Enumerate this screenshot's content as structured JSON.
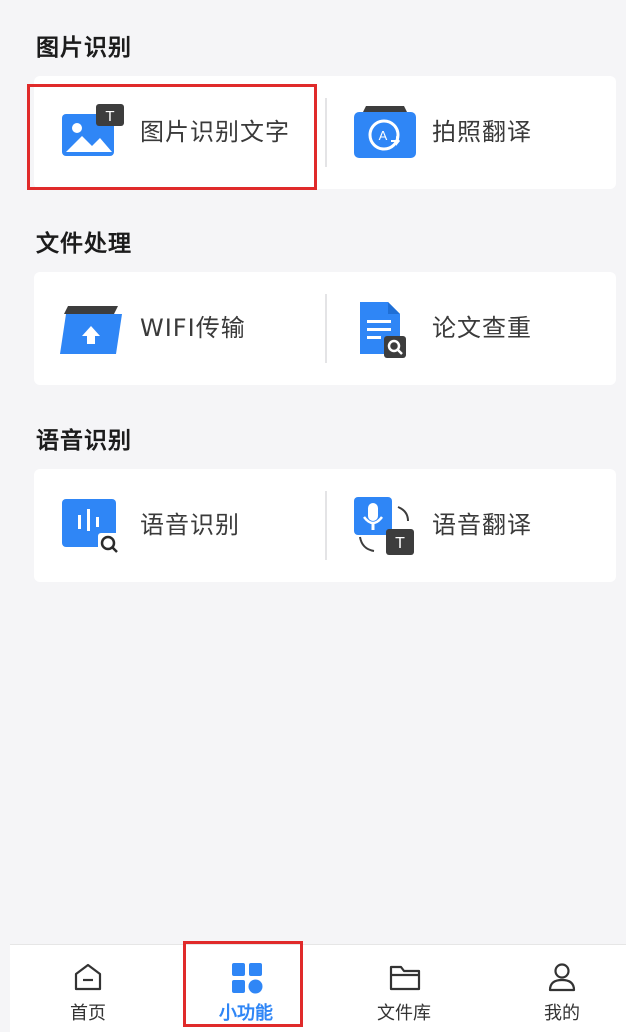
{
  "sections": [
    {
      "title": "图片识别",
      "items": [
        {
          "label": "图片识别文字",
          "icon": "image-text-icon"
        },
        {
          "label": "拍照翻译",
          "icon": "camera-translate-icon"
        }
      ]
    },
    {
      "title": "文件处理",
      "items": [
        {
          "label": "WIFI传输",
          "icon": "wifi-upload-folder-icon"
        },
        {
          "label": "论文查重",
          "icon": "document-search-icon"
        }
      ]
    },
    {
      "title": "语音识别",
      "items": [
        {
          "label": "语音识别",
          "icon": "voice-search-icon"
        },
        {
          "label": "语音翻译",
          "icon": "mic-translate-icon"
        }
      ]
    }
  ],
  "bottom_nav": {
    "items": [
      {
        "label": "首页",
        "icon": "home-icon",
        "active": false
      },
      {
        "label": "小功能",
        "icon": "grid-icon",
        "active": true
      },
      {
        "label": "文件库",
        "icon": "folder-icon",
        "active": false
      },
      {
        "label": "我的",
        "icon": "user-icon",
        "active": false
      }
    ]
  },
  "colors": {
    "accent": "#2f86f6",
    "highlight": "#e02a2a",
    "background": "#f5f5f7"
  }
}
